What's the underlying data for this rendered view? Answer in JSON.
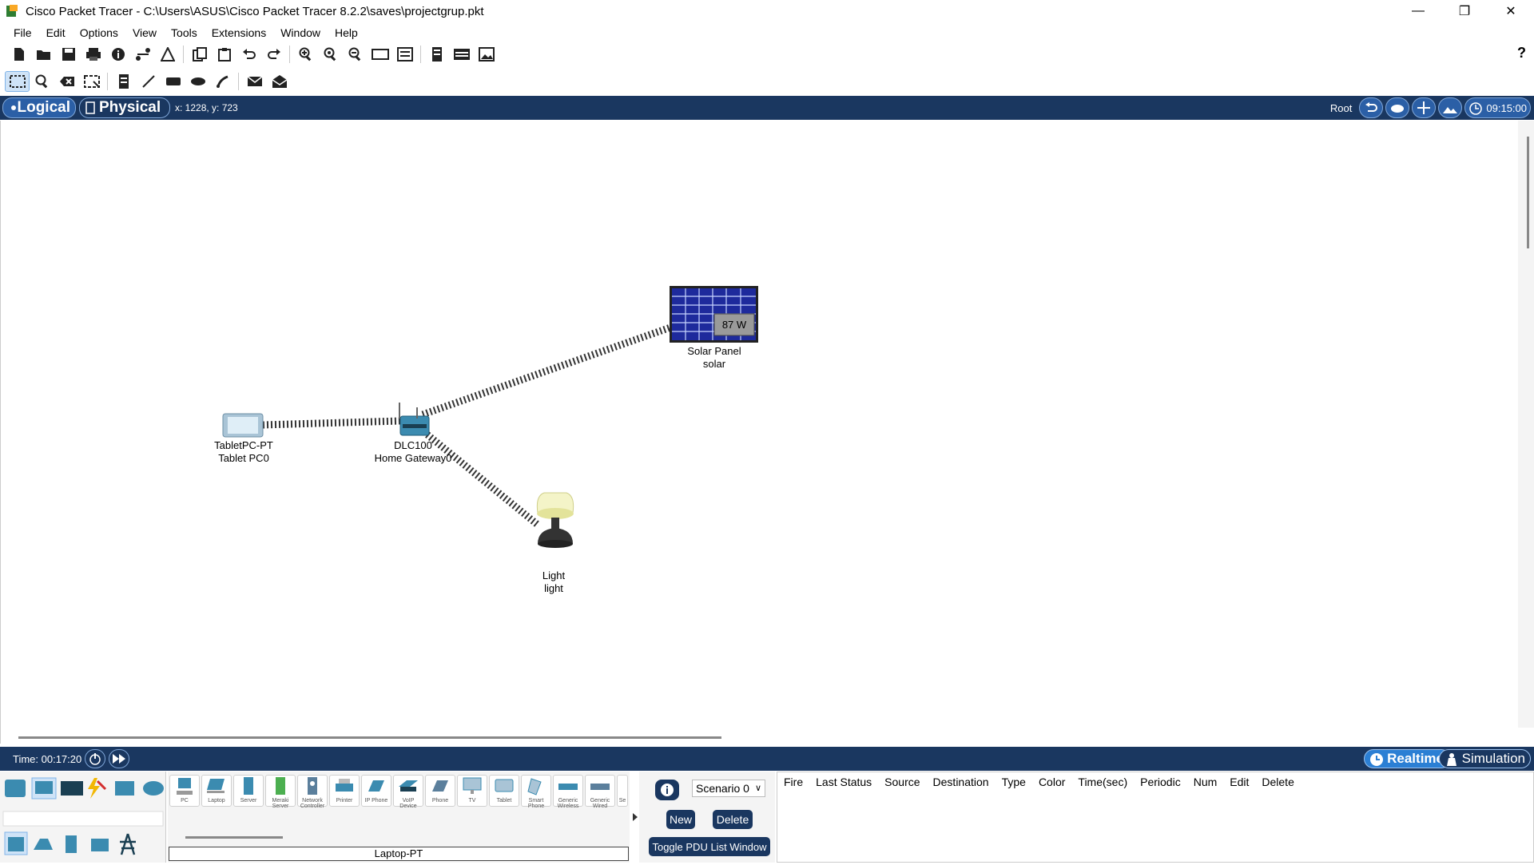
{
  "window": {
    "title": "Cisco Packet Tracer - C:\\Users\\ASUS\\Cisco Packet Tracer 8.2.2\\saves\\projectgrup.pkt",
    "controls": [
      "minimize-icon",
      "restore-icon",
      "close-icon"
    ]
  },
  "menu": [
    "File",
    "Edit",
    "Options",
    "View",
    "Tools",
    "Extensions",
    "Window",
    "Help"
  ],
  "toolbar1": [
    "new-icon",
    "open-icon",
    "save-icon",
    "print-icon",
    "info-icon",
    "network-icon",
    "activity-wizard-icon",
    "copy-icon",
    "paste-icon",
    "undo-icon",
    "redo-icon",
    "zoom-in-icon",
    "zoom-reset-icon",
    "zoom-out-icon",
    "drawing-palette-icon",
    "custom-device-icon",
    "pdu-list-icon",
    "view-icon",
    "screenshot-icon"
  ],
  "toolbar2": [
    "select-icon",
    "inspect-icon",
    "delete-icon",
    "resize-icon",
    "place-note-icon",
    "draw-line-icon",
    "draw-rectangle-icon",
    "draw-ellipse-icon",
    "freeform-icon",
    "add-simple-pdu-icon",
    "add-complex-pdu-icon"
  ],
  "help_label": "?",
  "navbar": {
    "logical_label": "Logical",
    "physical_label": "Physical",
    "coords": "x: 1228, y: 723",
    "root_label": "Root",
    "clock": "09:15:00"
  },
  "devices": [
    {
      "line1": "TabletPC-PT",
      "line2": "Tablet PC0"
    },
    {
      "line1": "DLC100",
      "line2": "Home Gateway0"
    },
    {
      "line1": "Solar Panel",
      "line2": "solar",
      "reading": "87 W"
    },
    {
      "line1": "Light",
      "line2": "light"
    }
  ],
  "timebar": {
    "time": "Time: 00:17:20",
    "realtime_label": "Realtime",
    "simulation_label": "Simulation"
  },
  "device_types": [
    "PC",
    "Laptop",
    "Server",
    "Meraki Server",
    "Network Controller",
    "Printer",
    "IP Phone",
    "VoIP Device",
    "Phone",
    "TV",
    "Tablet",
    "Smart Phone",
    "Generic Wireless",
    "Generic Wired",
    "Se"
  ],
  "selected_device_type": "Laptop-PT",
  "pdu": {
    "scenario": "Scenario 0",
    "new_label": "New",
    "delete_label": "Delete",
    "toggle_label": "Toggle PDU List Window",
    "columns": [
      "Fire",
      "Last Status",
      "Source",
      "Destination",
      "Type",
      "Color",
      "Time(sec)",
      "Periodic",
      "Num",
      "Edit",
      "Delete"
    ]
  },
  "colors": {
    "nav_bg": "#1a3760",
    "accent": "#2b7fd4",
    "panel_blue": "#1e2a9c"
  }
}
